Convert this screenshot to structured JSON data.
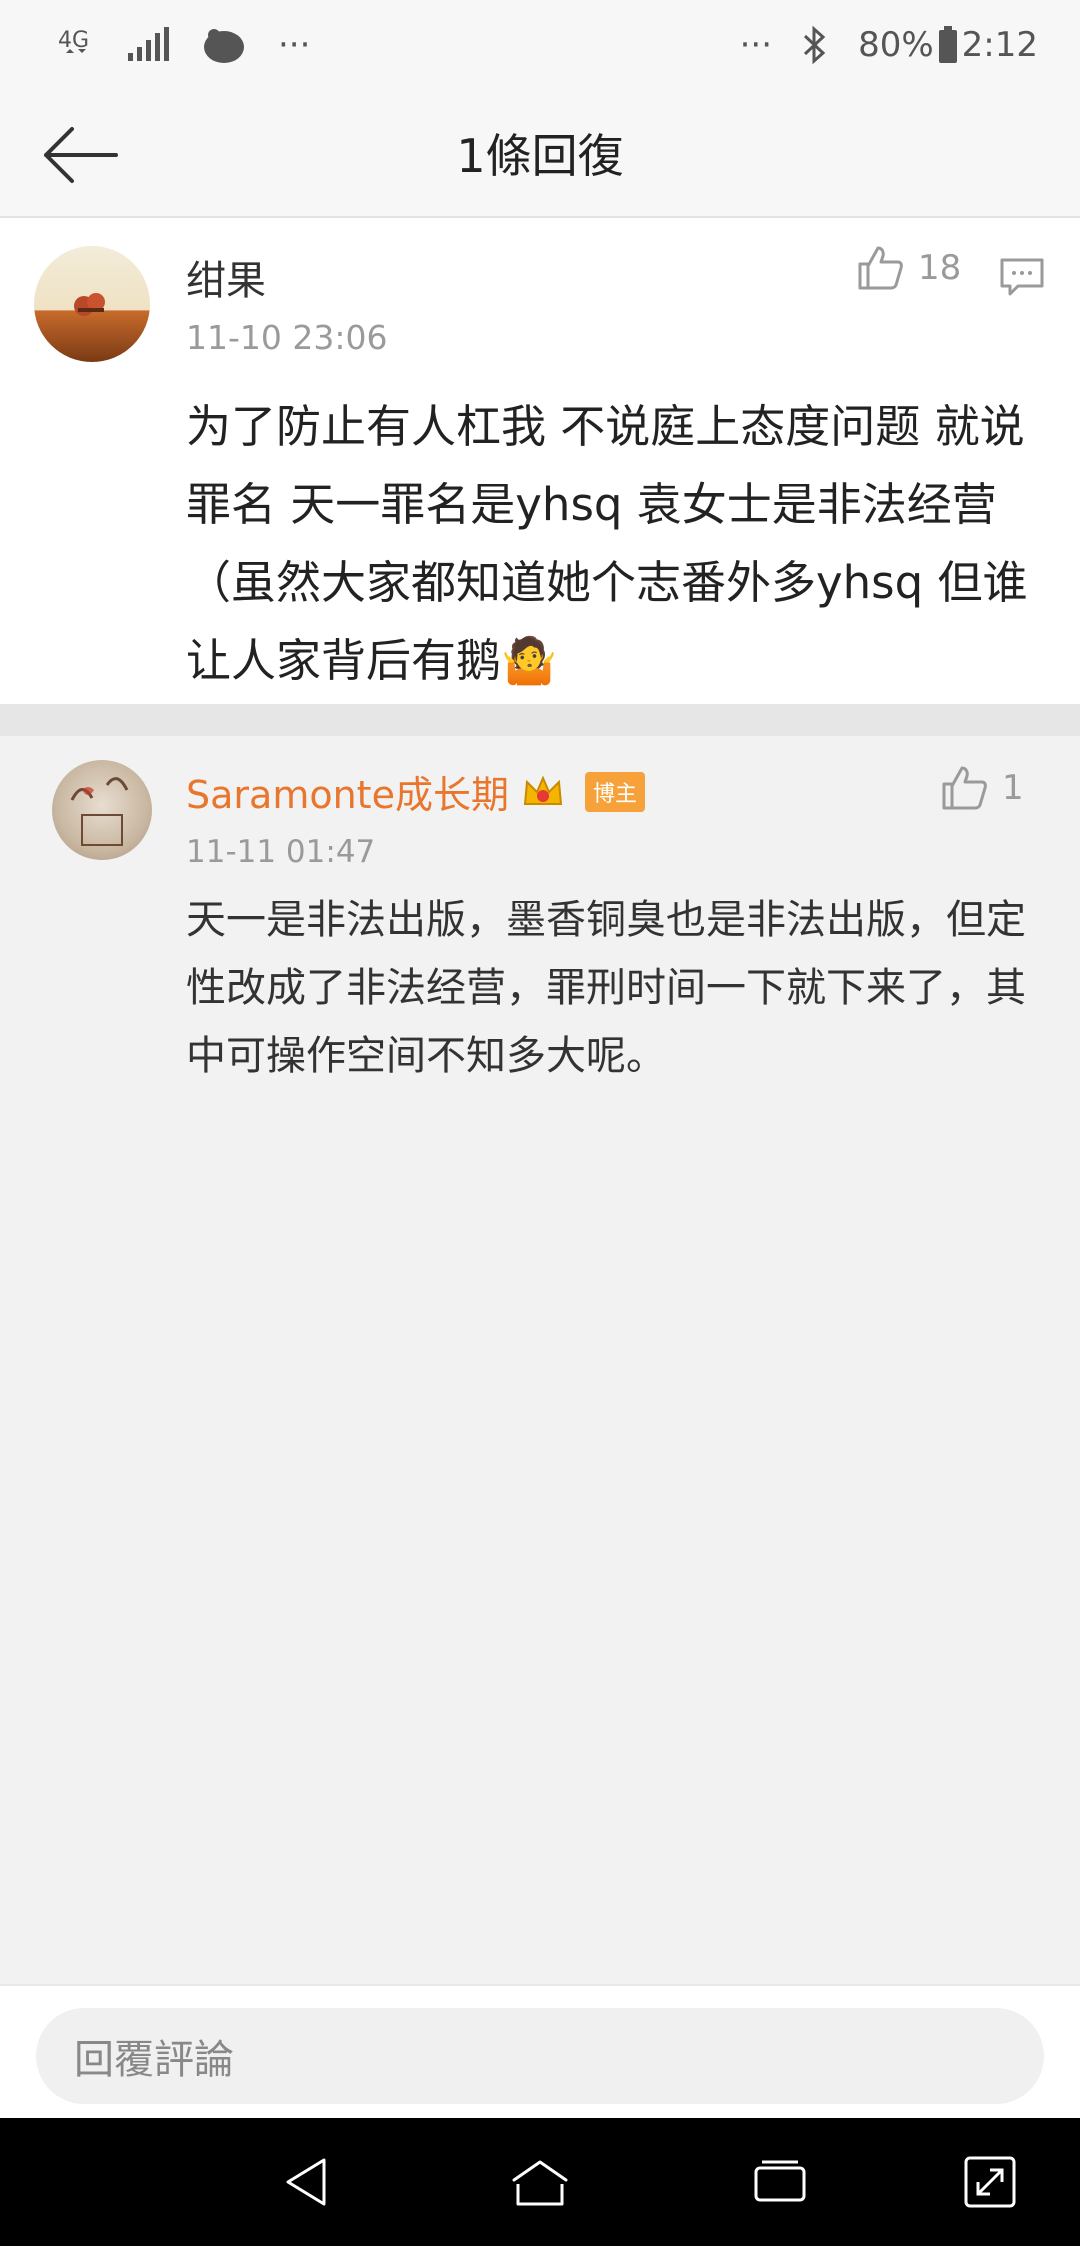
{
  "status_bar": {
    "network": "4G",
    "more": "···",
    "battery": "80%",
    "time": "2:12",
    "more_right": "···"
  },
  "header": {
    "title": "1條回復"
  },
  "main_comment": {
    "user": "绀果",
    "time": "11-10 23:06",
    "likes": "18",
    "text": "为了防止有人杠我 不说庭上态度问题 就说罪名 天一罪名是yhsq 袁女士是非法经营（虽然大家都知道她个志番外多yhsq 但谁让人家背后有鹅🤷"
  },
  "reply_comment": {
    "user": "Saramonte成长期",
    "badge": "博主",
    "time": "11-11 01:47",
    "likes": "1",
    "text": "天一是非法出版，墨香铜臭也是非法出版，但定性改成了非法经营，罪刑时间一下就下来了，其中可操作空间不知多大呢。"
  },
  "reply_bar": {
    "placeholder": "回覆評論"
  },
  "colors": {
    "accent_orange": "#e8762d",
    "badge_orange": "#f6a13a",
    "meta_gray": "#9a9a9a"
  }
}
